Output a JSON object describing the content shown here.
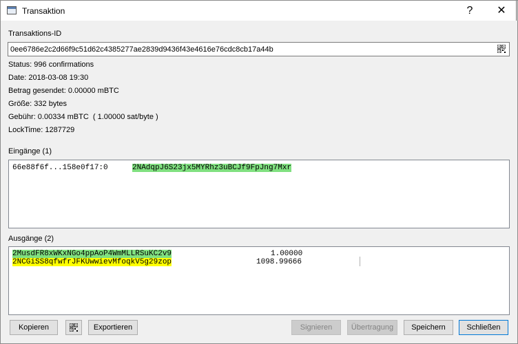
{
  "window": {
    "title": "Transaktion",
    "help_label": "?",
    "close_label": "✕",
    "app_icon": "window-icon"
  },
  "txid": {
    "label": "Transaktions-ID",
    "value": "0ee6786e2c2d66f9c51d62c4385277ae2839d9436f43e4616e76cdc8cb17a44b",
    "qr_icon": "qr-code-icon"
  },
  "details": {
    "status": "Status: 996 confirmations",
    "date": "Date: 2018-03-08 19:30",
    "sent": "Betrag gesendet: 0.00000 mBTC",
    "size": "Größe: 332 bytes",
    "fee": "Gebühr: 0.00334 mBTC  ( 1.00000 sat/byte )",
    "locktime": "LockTime: 1287729"
  },
  "inputs": {
    "label": "Eingänge (1)",
    "rows": [
      {
        "prevout": "66e88f6f...158e0f17:0",
        "address": "2NAdqpJ6S23jx5MYRhz3uBCJf9FpJng7Mxr",
        "highlight": "#80e080"
      }
    ]
  },
  "outputs": {
    "label": "Ausgänge (2)",
    "rows": [
      {
        "address": "2MusdFR8xWKxNGo4ppAoP4WmMLLRSuKC2v9",
        "amount": "1.00000",
        "highlight": "#80e080"
      },
      {
        "address": "2NCGiSS8qfwfrJFKUwwievMfoqkV5g29zop",
        "amount": "1098.99666",
        "highlight": "#ffff00"
      }
    ]
  },
  "buttons": {
    "copy": "Kopieren",
    "qr_icon": "qr-code-icon",
    "export": "Exportieren",
    "sign": "Signieren",
    "broadcast": "Übertragung",
    "save": "Speichern",
    "close": "Schließen"
  }
}
